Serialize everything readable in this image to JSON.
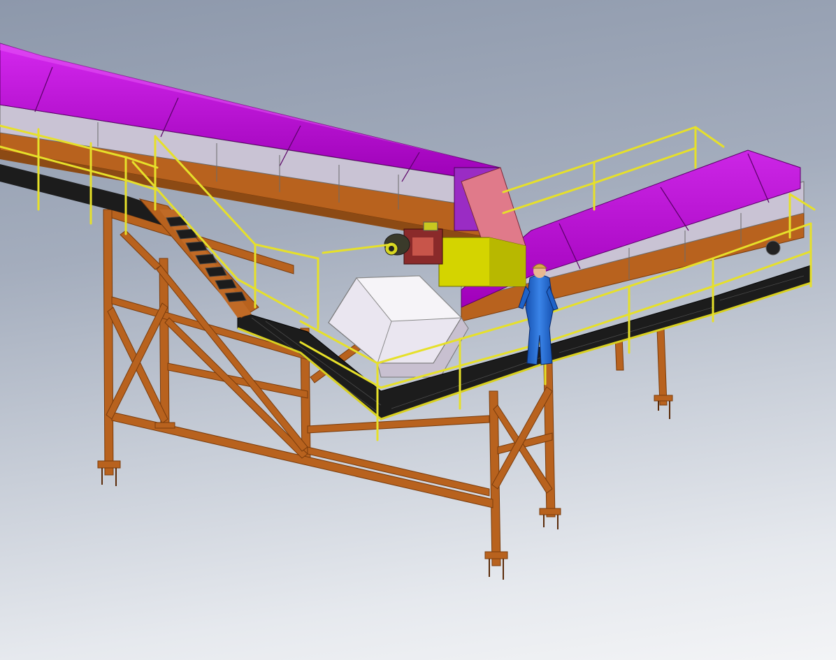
{
  "viewport": {
    "background_top": "#8d98ab",
    "background_bottom": "#f3f4f6"
  },
  "scene": {
    "components": [
      "main-conveyor",
      "branch-conveyor",
      "transfer-chute",
      "drive-motor",
      "walkway",
      "stairway",
      "handrails",
      "support-structure",
      "human-figure"
    ]
  },
  "colors": {
    "conveyor_cover": "#b000c8",
    "cover_top": "#c81ee0",
    "structure_steel": "#b8621e",
    "handrail": "#e6e02a",
    "walkway_grating": "#1c1c1c",
    "chute_yellow": "#d4d400",
    "chute_pink": "#e07a8a",
    "motor_body": "#8a8a2a",
    "person_suit": "#1f63c8",
    "person_helmet": "#d8a84a"
  }
}
